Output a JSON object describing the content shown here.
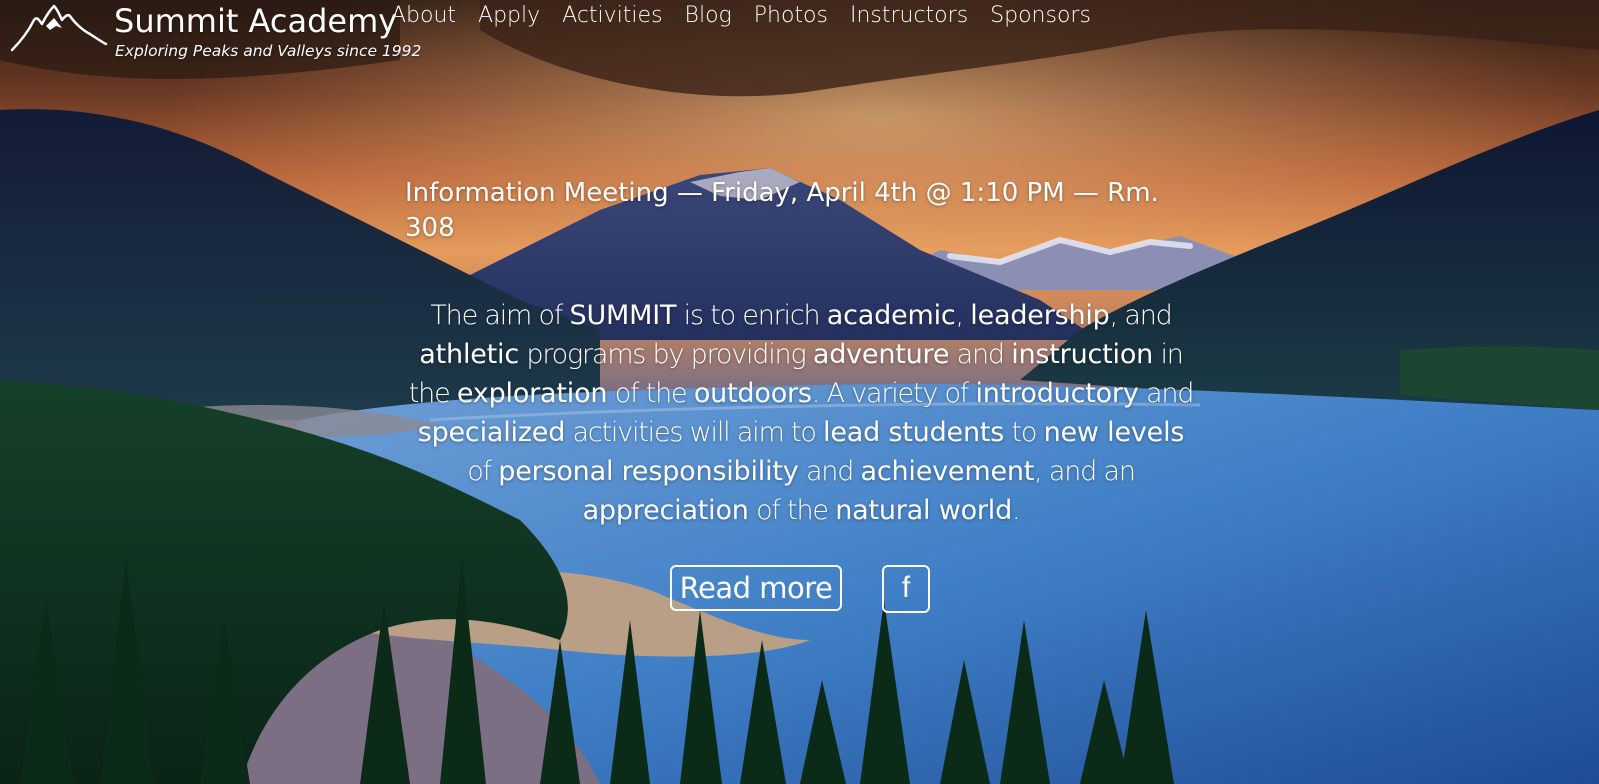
{
  "site": {
    "title": "Summit Academy",
    "tagline": "Exploring Peaks and Valleys since 1992",
    "logo_icon": "mountain-peaks-logo"
  },
  "nav": [
    "About",
    "Apply",
    "Activities",
    "Blog",
    "Photos",
    "Instructors",
    "Sponsors"
  ],
  "announcement": "Information Meeting — Friday, April 4th @ 1:10 PM — Rm. 308",
  "mission": [
    {
      "t": "The aim of ",
      "h": false
    },
    {
      "t": "SUMMIT",
      "h": true
    },
    {
      "t": " is to enrich ",
      "h": false
    },
    {
      "t": "academic",
      "h": true
    },
    {
      "t": ", ",
      "h": false
    },
    {
      "t": "leadership",
      "h": true
    },
    {
      "t": ", and ",
      "h": false
    },
    {
      "t": "athletic",
      "h": true
    },
    {
      "t": " programs by providing ",
      "h": false
    },
    {
      "t": "adventure",
      "h": true
    },
    {
      "t": " and ",
      "h": false
    },
    {
      "t": "instruction",
      "h": true
    },
    {
      "t": " in the ",
      "h": false
    },
    {
      "t": "exploration",
      "h": true
    },
    {
      "t": " of the ",
      "h": false
    },
    {
      "t": "outdoors",
      "h": true
    },
    {
      "t": ". A variety of ",
      "h": false
    },
    {
      "t": "introductory",
      "h": true
    },
    {
      "t": " and ",
      "h": false
    },
    {
      "t": "specialized",
      "h": true
    },
    {
      "t": " activities will aim to ",
      "h": false
    },
    {
      "t": "lead students",
      "h": true
    },
    {
      "t": " to ",
      "h": false
    },
    {
      "t": "new levels",
      "h": true
    },
    {
      "t": " of ",
      "h": false
    },
    {
      "t": "personal responsibility",
      "h": true
    },
    {
      "t": " and ",
      "h": false
    },
    {
      "t": "achievement",
      "h": true
    },
    {
      "t": ", and an ",
      "h": false
    },
    {
      "t": "appreciation",
      "h": true
    },
    {
      "t": " of the ",
      "h": false
    },
    {
      "t": "natural world",
      "h": true
    },
    {
      "t": ".",
      "h": false
    }
  ],
  "buttons": {
    "read_more": "Read more",
    "facebook": "f",
    "facebook_icon": "facebook-icon"
  },
  "colors": {
    "text": "#ffffff",
    "sky_top": "#3a2418",
    "sunset_glow": "#e08a4a",
    "mountain_dark": "#0e1c3a",
    "lake": "#3f7fc6",
    "forest": "#0e2f1d"
  }
}
